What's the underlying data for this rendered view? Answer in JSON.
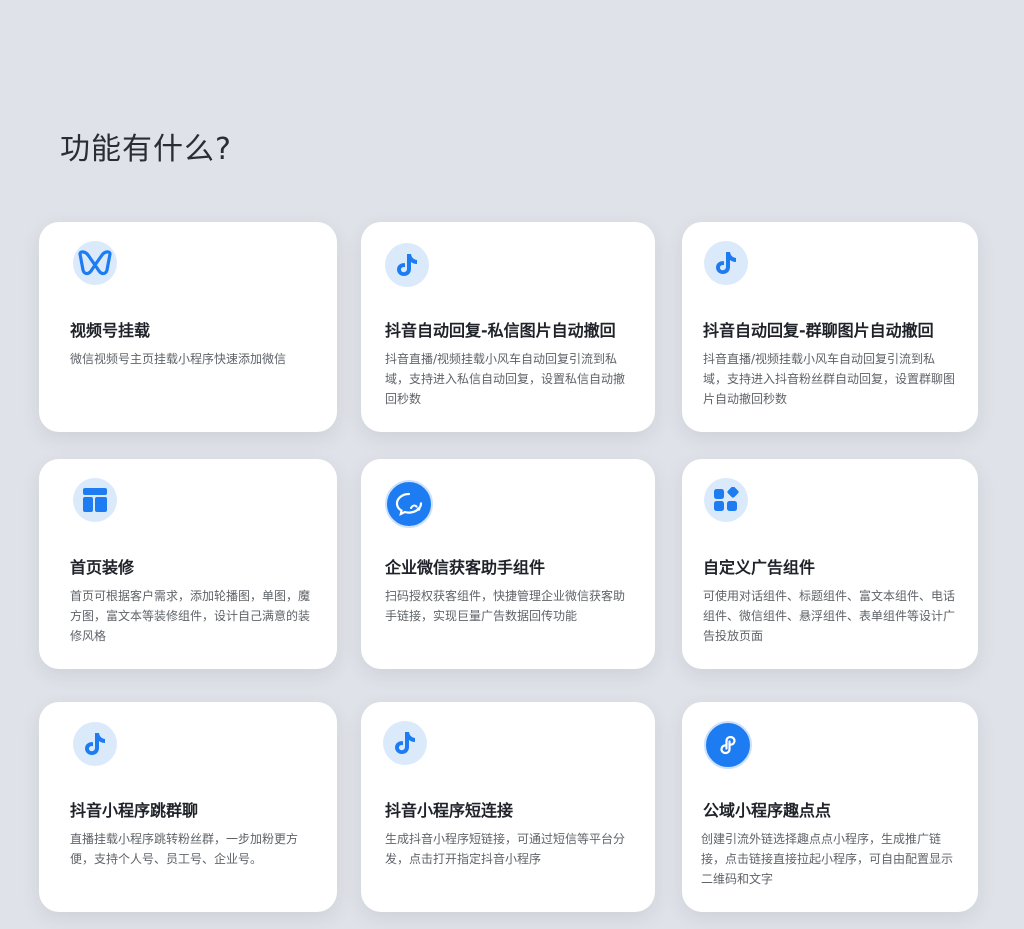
{
  "page": {
    "title": "功能有什么?"
  },
  "cards": [
    {
      "icon": "butterfly-icon",
      "title": "视频号挂载",
      "desc": "微信视频号主页挂载小程序快速添加微信"
    },
    {
      "icon": "tiktok-icon",
      "title": "抖音自动回复-私信图片自动撤回",
      "desc": "抖音直播/视频挂载小风车自动回复引流到私域，支持进入私信自动回复，设置私信自动撤回秒数"
    },
    {
      "icon": "tiktok-icon",
      "title": "抖音自动回复-群聊图片自动撤回",
      "desc": "抖音直播/视频挂载小风车自动回复引流到私域，支持进入抖音粉丝群自动回复，设置群聊图片自动撤回秒数"
    },
    {
      "icon": "layout-icon",
      "title": "首页装修",
      "desc": "首页可根据客户需求，添加轮播图，单图，魔方图，富文本等装修组件，设计自己满意的装修风格"
    },
    {
      "icon": "wecom-icon",
      "title": "企业微信获客助手组件",
      "desc": "扫码授权获客组件，快捷管理企业微信获客助手链接，实现巨量广告数据回传功能"
    },
    {
      "icon": "widgets-icon",
      "title": "自定义广告组件",
      "desc": "可使用对话组件、标题组件、富文本组件、电话组件、微信组件、悬浮组件、表单组件等设计广告投放页面"
    },
    {
      "icon": "tiktok-icon",
      "title": "抖音小程序跳群聊",
      "desc": "直播挂载小程序跳转粉丝群，一步加粉更方便，支持个人号、员工号、企业号。"
    },
    {
      "icon": "tiktok-icon",
      "title": "抖音小程序短连接",
      "desc": "生成抖音小程序短链接，可通过短信等平台分发，点击打开指定抖音小程序"
    },
    {
      "icon": "miniprogram-icon",
      "title": "公域小程序趣点点",
      "desc": "创建引流外链选择趣点点小程序，生成推广链接，点击链接直接拉起小程序，可自由配置显示二维码和文字"
    }
  ],
  "colors": {
    "background": "#dfe2e8",
    "card": "#ffffff",
    "accent": "#1e7cf2",
    "icon_bg": "#dbeafb"
  }
}
